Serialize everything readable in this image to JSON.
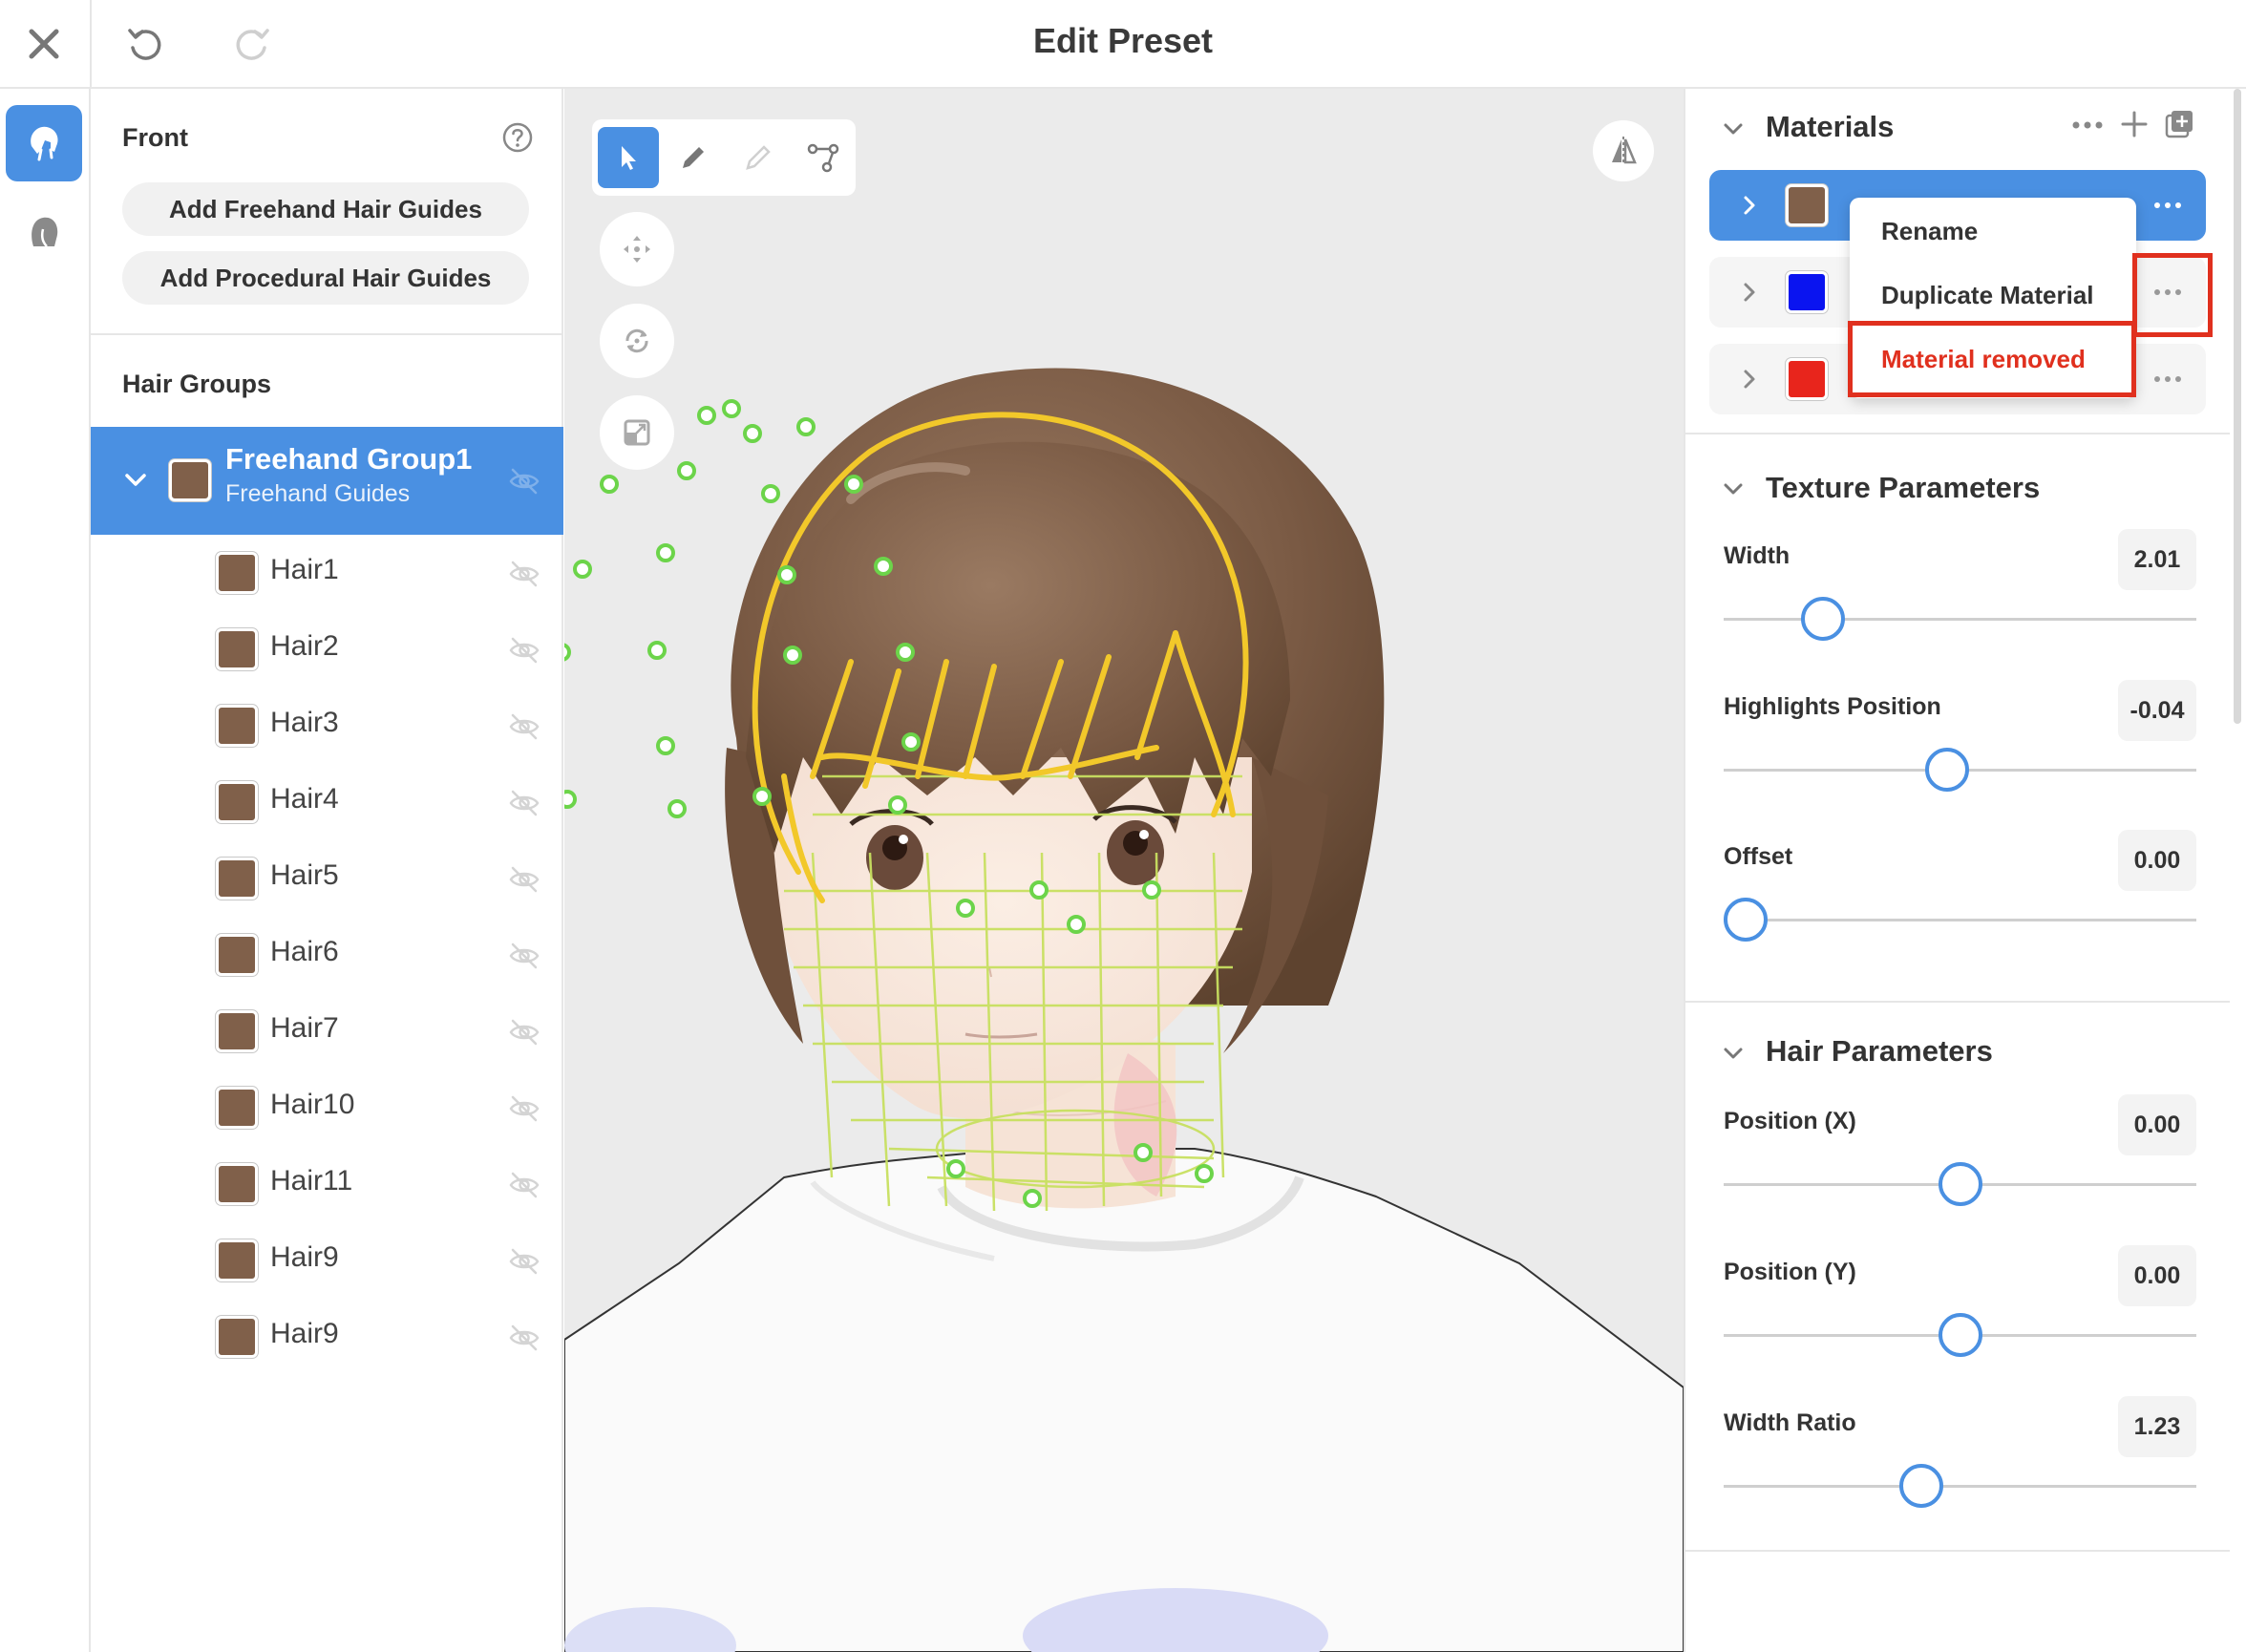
{
  "topbar": {
    "title": "Edit Preset",
    "close_icon": "close-icon",
    "undo_icon": "undo-icon",
    "redo_icon": "redo-icon"
  },
  "rail": {
    "items": [
      {
        "icon": "hair-icon",
        "active": true
      },
      {
        "icon": "head-profile-icon",
        "active": false
      }
    ]
  },
  "left_panel": {
    "view_title": "Front",
    "help_icon": "help-icon",
    "add_freehand_label": "Add Freehand Hair Guides",
    "add_procedural_label": "Add Procedural Hair Guides",
    "hair_groups_title": "Hair Groups",
    "group": {
      "name": "Freehand Group1",
      "subtitle": "Freehand Guides",
      "color": "#80604a"
    },
    "hairs": [
      {
        "label": "Hair1",
        "color": "#80604a"
      },
      {
        "label": "Hair2",
        "color": "#80604a"
      },
      {
        "label": "Hair3",
        "color": "#80604a"
      },
      {
        "label": "Hair4",
        "color": "#80604a"
      },
      {
        "label": "Hair5",
        "color": "#80604a"
      },
      {
        "label": "Hair6",
        "color": "#80604a"
      },
      {
        "label": "Hair7",
        "color": "#80604a"
      },
      {
        "label": "Hair10",
        "color": "#80604a"
      },
      {
        "label": "Hair11",
        "color": "#80604a"
      },
      {
        "label": "Hair9",
        "color": "#80604a"
      },
      {
        "label": "Hair9",
        "color": "#80604a"
      }
    ]
  },
  "viewport": {
    "tools": [
      "select-tool-icon",
      "pen-tool-icon",
      "eraser-tool-icon",
      "path-tool-icon"
    ],
    "active_tool": "select-tool-icon",
    "nav_buttons": [
      "move-icon",
      "rotate-icon",
      "fit-icon"
    ],
    "mirror_icon": "mirror-icon"
  },
  "right_panel": {
    "materials_title": "Materials",
    "materials": [
      {
        "color": "#80604a",
        "selected": true
      },
      {
        "color": "#0a14f0",
        "selected": false
      },
      {
        "color": "#e8251c",
        "selected": false
      }
    ],
    "context_menu": {
      "rename_label": "Rename",
      "duplicate_label": "Duplicate Material",
      "removed_label": "Material removed"
    },
    "texture_title": "Texture Parameters",
    "texture_params": [
      {
        "label": "Width",
        "value": "2.01",
        "fraction": 0.18
      },
      {
        "label": "Highlights Position",
        "value": "-0.04",
        "fraction": 0.47
      },
      {
        "label": "Offset",
        "value": "0.00",
        "fraction": 0.0
      }
    ],
    "hair_title": "Hair Parameters",
    "hair_params": [
      {
        "label": "Position (X)",
        "value": "0.00",
        "fraction": 0.5
      },
      {
        "label": "Position (Y)",
        "value": "0.00",
        "fraction": 0.5
      },
      {
        "label": "Width Ratio",
        "value": "1.23",
        "fraction": 0.41
      }
    ]
  },
  "colors": {
    "accent": "#4a90e2",
    "highlight_red": "#e0301e",
    "hair_brown": "#80604a",
    "guide_yellow": "#f2c82a",
    "mesh_green": "#c8e060"
  }
}
